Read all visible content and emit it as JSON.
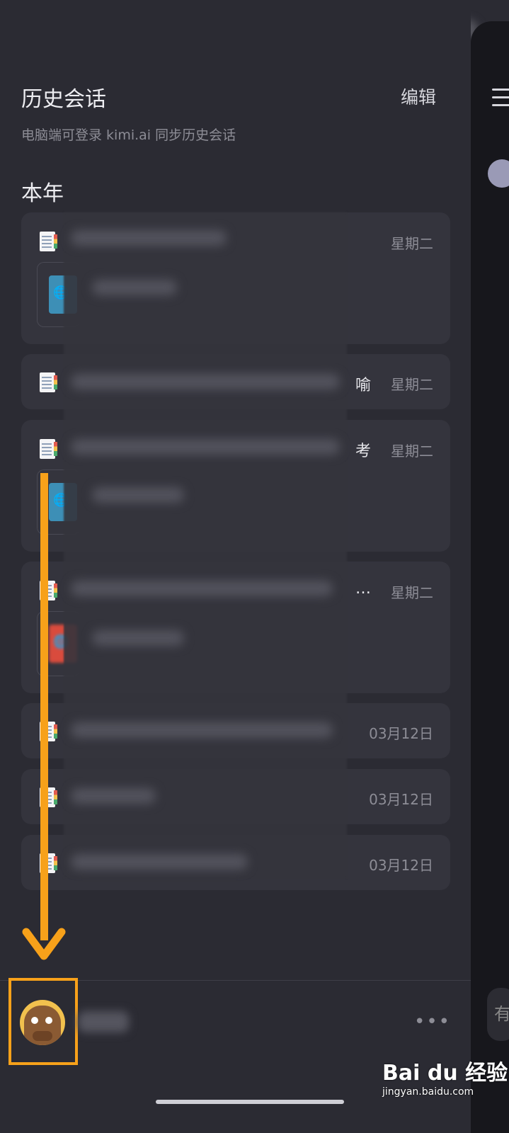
{
  "header": {
    "title": "历史会话",
    "edit_label": "编辑",
    "subtitle": "电脑端可登录 kimi.ai  同步历史会话"
  },
  "section_label": "本年",
  "conversations": [
    {
      "date": "星期二",
      "trailing_text": "",
      "has_attachment": true,
      "attachment_icon": "web-icon"
    },
    {
      "date": "星期二",
      "trailing_text": "喻",
      "has_attachment": false
    },
    {
      "date": "星期二",
      "trailing_text": "考",
      "has_attachment": true,
      "attachment_icon": "web-icon"
    },
    {
      "date": "星期二",
      "trailing_text": "…",
      "has_attachment": true,
      "attachment_icon": "pdf-icon"
    },
    {
      "date": "03月12日",
      "trailing_text": "",
      "has_attachment": false
    },
    {
      "date": "03月12日",
      "trailing_text": "",
      "has_attachment": false
    },
    {
      "date": "03月12日",
      "trailing_text": "",
      "has_attachment": false
    }
  ],
  "footer": {
    "more_label": "•••"
  },
  "right_panel": {
    "input_hint": "有"
  },
  "watermark": {
    "logo": "Bai du 经验",
    "url": "jingyan.baidu.com"
  },
  "colors": {
    "background": "#2b2b33",
    "card": "#34343d",
    "annotation": "#f7a11a"
  }
}
